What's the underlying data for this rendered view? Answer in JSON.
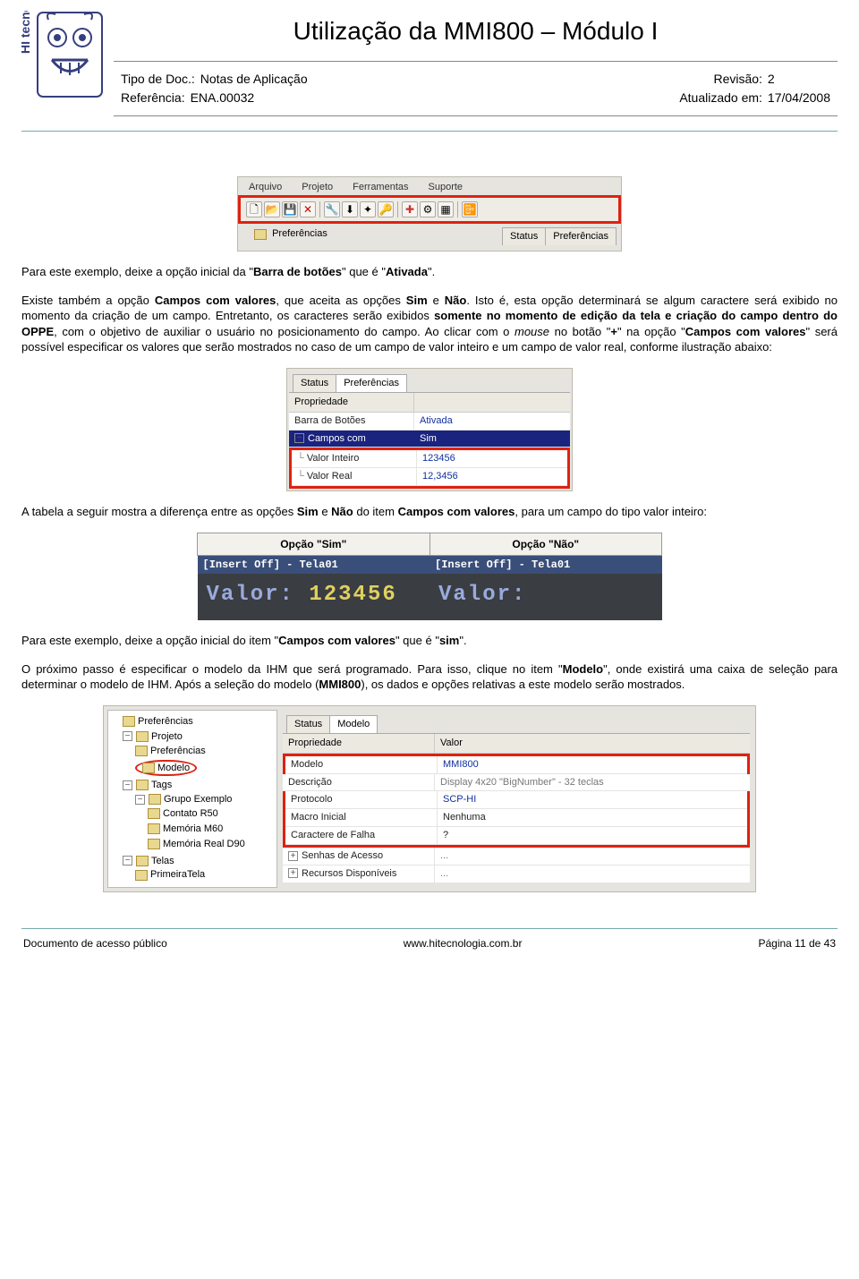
{
  "header": {
    "title": "Utilização da MMI800 – Módulo I",
    "meta_left": {
      "l1_label": "Tipo de Doc.:",
      "l1_value": "Notas de Aplicação",
      "l2_label": "Referência:",
      "l2_value": "ENA.00032"
    },
    "meta_right": {
      "l1_label": "Revisão:",
      "l1_value": "2",
      "l2_label": "Atualizado em:",
      "l2_value": "17/04/2008"
    }
  },
  "toolbar_shot": {
    "menus": [
      "Arquivo",
      "Projeto",
      "Ferramentas",
      "Suporte"
    ],
    "tree_label": "Preferências",
    "tabs": [
      "Status",
      "Preferências"
    ]
  },
  "para1": "Para este exemplo, deixe a opção inicial da \"",
  "para1_b1": "Barra de botões",
  "para1_mid": "\" que é \"",
  "para1_b2": "Ativada",
  "para1_end": "\".",
  "para2_a": "Existe também a opção ",
  "para2_b1": "Campos com valores",
  "para2_b": ", que aceita as opções ",
  "para2_b2": "Sim",
  "para2_c": " e ",
  "para2_b3": "Não",
  "para2_d": ". Isto é, esta opção determinará se algum caractere será exibido no momento da criação de um campo. Entretanto, os caracteres serão exibidos ",
  "para2_b4": "somente no momento de edição da tela e criação do campo dentro do OPPE",
  "para2_e": ", com o objetivo de auxiliar o usuário no posicionamento do campo. Ao clicar com o ",
  "para2_i1": "mouse",
  "para2_f": " no botão \"",
  "para2_b5": "+",
  "para2_g": "\" na opção \"",
  "para2_b6": "Campos com valores",
  "para2_h": "\" será possível especificar os valores que serão mostrados no caso de um campo de valor inteiro e um campo de valor real, conforme ilustração abaixo:",
  "prefs_shot": {
    "tabs": [
      "Status",
      "Preferências"
    ],
    "head": "Propriedade",
    "rows": {
      "barra_k": "Barra de Botões",
      "barra_v": "Ativada",
      "campos_k": "Campos com",
      "campos_v": "Sim",
      "vint_k": "Valor Inteiro",
      "vint_v": "123456",
      "vreal_k": "Valor Real",
      "vreal_v": "12,3456"
    }
  },
  "para3_a": "A tabela a seguir mostra a diferença entre as opções ",
  "para3_b1": "Sim",
  "para3_b": " e ",
  "para3_b2": "Não",
  "para3_c": " do item ",
  "para3_b3": "Campos com valores",
  "para3_d": ", para um campo do tipo valor inteiro:",
  "cmp": {
    "h1": "Opção \"Sim\"",
    "h2": "Opção \"Não\"",
    "title": "[Insert Off] - Tela01",
    "label": "Valor:",
    "val_sim": "123456",
    "val_nao": ""
  },
  "para4_a": "Para este exemplo, deixe a opção inicial do item \"",
  "para4_b1": "Campos com valores",
  "para4_b": "\" que é \"",
  "para4_b2": "sim",
  "para4_c": "\".",
  "para5_a": "O próximo passo é especificar o modelo da IHM que será programado. Para isso, clique no item \"",
  "para5_b1": "Modelo",
  "para5_b": "\", onde existirá uma caixa de seleção para determinar o modelo de IHM. Após a seleção do modelo (",
  "para5_b2": "MMI800",
  "para5_c": "), os dados e opções relativas a este modelo serão mostrados.",
  "model_shot": {
    "tree": {
      "n0": "Preferências",
      "n1": "Projeto",
      "n1a": "Preferências",
      "n1b": "Modelo",
      "n2": "Tags",
      "n2a": "Grupo Exemplo",
      "n2a1": "Contato R50",
      "n2a2": "Memória M60",
      "n2a3": "Memória Real D90",
      "n3": "Telas",
      "n3a": "PrimeiraTela"
    },
    "tabs": [
      "Status",
      "Modelo"
    ],
    "head_k": "Propriedade",
    "head_v": "Valor",
    "rows": {
      "modelo_k": "Modelo",
      "modelo_v": "MMI800",
      "desc_k": "Descrição",
      "desc_v": "Display 4x20 \"BigNumber\" - 32 teclas",
      "proto_k": "Protocolo",
      "proto_v": "SCP-HI",
      "macro_k": "Macro Inicial",
      "macro_v": "Nenhuma",
      "falha_k": "Caractere de Falha",
      "falha_v": "?",
      "senhas_k": "Senhas de Acesso",
      "senhas_v": "...",
      "rec_k": "Recursos Disponíveis",
      "rec_v": "..."
    }
  },
  "footer": {
    "left": "Documento de acesso público",
    "center": "www.hitecnologia.com.br",
    "right": "Página 11 de 43"
  }
}
